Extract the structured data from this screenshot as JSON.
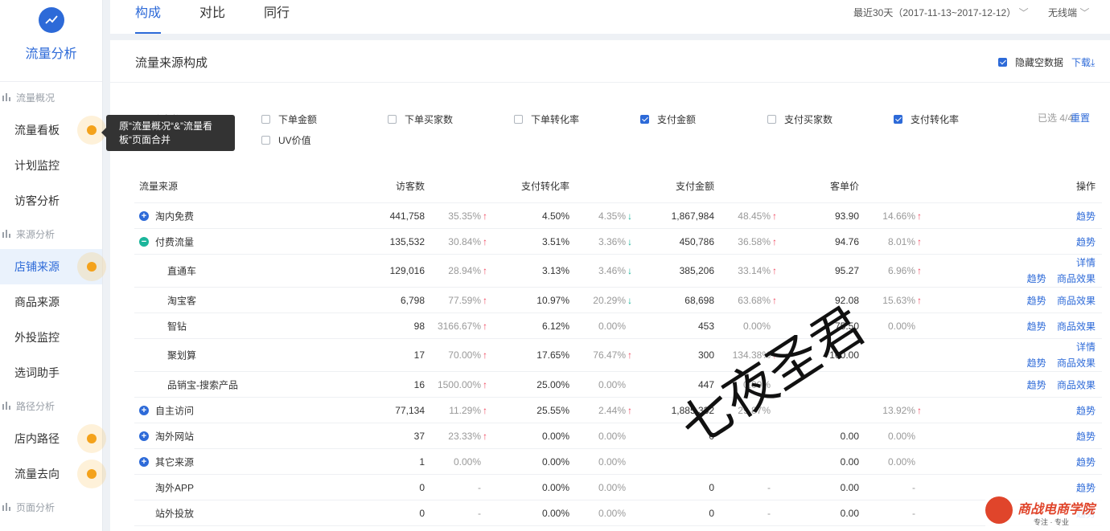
{
  "sidebar": {
    "title": "流量分析",
    "sections": [
      {
        "label": "流量概况",
        "items": [
          {
            "label": "流量看板"
          },
          {
            "label": "计划监控"
          },
          {
            "label": "访客分析"
          }
        ]
      },
      {
        "label": "来源分析",
        "items": [
          {
            "label": "店铺来源"
          },
          {
            "label": "商品来源"
          },
          {
            "label": "外投监控"
          },
          {
            "label": "选词助手"
          }
        ]
      },
      {
        "label": "路径分析",
        "items": [
          {
            "label": "店内路径"
          },
          {
            "label": "流量去向"
          }
        ]
      },
      {
        "label": "页面分析",
        "items": []
      }
    ]
  },
  "tooltip": {
    "text": "原“流量概况“&”流量看板“页面合并"
  },
  "tabs": [
    {
      "label": "构成"
    },
    {
      "label": "对比"
    },
    {
      "label": "同行"
    }
  ],
  "date_range": "最近30天（2017-11-13~2017-12-12）",
  "device": "无线端",
  "panel": {
    "title": "流量来源构成",
    "hide_empty_label": "隐藏空数据",
    "download_label": "下载",
    "metrics": [
      {
        "label": "访客数",
        "checked": true
      },
      {
        "label": "下单金额",
        "checked": false
      },
      {
        "label": "下单买家数",
        "checked": false
      },
      {
        "label": "下单转化率",
        "checked": false
      },
      {
        "label": "支付金额",
        "checked": true
      },
      {
        "label": "支付买家数",
        "checked": false
      },
      {
        "label": "支付转化率",
        "checked": true
      },
      {
        "label": "UV价值",
        "checked": false
      }
    ],
    "selected_count": "已选 4/4",
    "reset_label": "重置"
  },
  "table": {
    "headers": [
      "流量来源",
      "访客数",
      "支付转化率",
      "支付金额",
      "客单价",
      "操作"
    ],
    "trend_label": "趋势",
    "detail_label": "详情",
    "goods_effect_label": "商品效果",
    "rows": [
      {
        "name": "淘内免费",
        "expand": "plus",
        "indent": false,
        "visitors": "441,758",
        "visitors_pct": "35.35%",
        "visitors_dir": "up",
        "conv": "4.50%",
        "conv_pct": "4.35%",
        "conv_dir": "down",
        "amount": "1,867,984",
        "amount_pct": "48.45%",
        "amount_dir": "up",
        "price": "93.90",
        "price_pct": "14.66%",
        "price_dir": "up",
        "ops": "trend"
      },
      {
        "name": "付费流量",
        "expand": "minus",
        "indent": false,
        "visitors": "135,532",
        "visitors_pct": "30.84%",
        "visitors_dir": "up",
        "conv": "3.51%",
        "conv_pct": "3.36%",
        "conv_dir": "down",
        "amount": "450,786",
        "amount_pct": "36.58%",
        "amount_dir": "up",
        "price": "94.76",
        "price_pct": "8.01%",
        "price_dir": "up",
        "ops": "trend"
      },
      {
        "name": "直通车",
        "expand": "none",
        "indent": true,
        "visitors": "129,016",
        "visitors_pct": "28.94%",
        "visitors_dir": "up",
        "conv": "3.13%",
        "conv_pct": "3.46%",
        "conv_dir": "down",
        "amount": "385,206",
        "amount_pct": "33.14%",
        "amount_dir": "up",
        "price": "95.27",
        "price_pct": "6.96%",
        "price_dir": "up",
        "ops": "detail"
      },
      {
        "name": "淘宝客",
        "expand": "none",
        "indent": true,
        "visitors": "6,798",
        "visitors_pct": "77.59%",
        "visitors_dir": "up",
        "conv": "10.97%",
        "conv_pct": "20.29%",
        "conv_dir": "down",
        "amount": "68,698",
        "amount_pct": "63.68%",
        "amount_dir": "up",
        "price": "92.08",
        "price_pct": "15.63%",
        "price_dir": "up",
        "ops": "goods"
      },
      {
        "name": "智钻",
        "expand": "none",
        "indent": true,
        "visitors": "98",
        "visitors_pct": "3166.67%",
        "visitors_dir": "up",
        "conv": "6.12%",
        "conv_pct": "0.00%",
        "conv_dir": "none",
        "amount": "453",
        "amount_pct": "0.00%",
        "amount_dir": "none",
        "price": "75.50",
        "price_pct": "0.00%",
        "price_dir": "none",
        "ops": "goods"
      },
      {
        "name": "聚划算",
        "expand": "none",
        "indent": true,
        "visitors": "17",
        "visitors_pct": "70.00%",
        "visitors_dir": "up",
        "conv": "17.65%",
        "conv_pct": "76.47%",
        "conv_dir": "up",
        "amount": "300",
        "amount_pct": "134.38%",
        "amount_dir": "up",
        "price": "100.00",
        "price_pct": "",
        "price_dir": "none",
        "ops": "detail"
      },
      {
        "name": "品销宝-搜索产品",
        "expand": "none",
        "indent": true,
        "visitors": "16",
        "visitors_pct": "1500.00%",
        "visitors_dir": "up",
        "conv": "25.00%",
        "conv_pct": "0.00%",
        "conv_dir": "none",
        "amount": "447",
        "amount_pct": "0.00%",
        "amount_dir": "none",
        "price": "",
        "price_pct": "",
        "price_dir": "none",
        "ops": "goods"
      },
      {
        "name": "自主访问",
        "expand": "plus",
        "indent": false,
        "visitors": "77,134",
        "visitors_pct": "11.29%",
        "visitors_dir": "up",
        "conv": "25.55%",
        "conv_pct": "2.44%",
        "conv_dir": "up",
        "amount": "1,885,332",
        "amount_pct": "29.87%",
        "amount_dir": "none",
        "price": "",
        "price_pct": "13.92%",
        "price_dir": "up",
        "ops": "trend"
      },
      {
        "name": "淘外网站",
        "expand": "plus",
        "indent": false,
        "visitors": "37",
        "visitors_pct": "23.33%",
        "visitors_dir": "up",
        "conv": "0.00%",
        "conv_pct": "0.00%",
        "conv_dir": "none",
        "amount": "0",
        "amount_pct": "",
        "amount_dir": "none",
        "price": "0.00",
        "price_pct": "0.00%",
        "price_dir": "none",
        "ops": "trend"
      },
      {
        "name": "其它来源",
        "expand": "plus",
        "indent": false,
        "visitors": "1",
        "visitors_pct": "0.00%",
        "visitors_dir": "none",
        "conv": "0.00%",
        "conv_pct": "0.00%",
        "conv_dir": "none",
        "amount": "",
        "amount_pct": "",
        "amount_dir": "none",
        "price": "0.00",
        "price_pct": "0.00%",
        "price_dir": "none",
        "ops": "trend"
      },
      {
        "name": "淘外APP",
        "expand": "none",
        "indent": false,
        "visitors": "0",
        "visitors_pct": "-",
        "visitors_dir": "none",
        "conv": "0.00%",
        "conv_pct": "0.00%",
        "conv_dir": "none",
        "amount": "0",
        "amount_pct": "-",
        "amount_dir": "none",
        "price": "0.00",
        "price_pct": "-",
        "price_dir": "none",
        "ops": "trend"
      },
      {
        "name": "站外投放",
        "expand": "none",
        "indent": false,
        "visitors": "0",
        "visitors_pct": "-",
        "visitors_dir": "none",
        "conv": "0.00%",
        "conv_pct": "0.00%",
        "conv_dir": "none",
        "amount": "0",
        "amount_pct": "-",
        "amount_dir": "none",
        "price": "0.00",
        "price_pct": "-",
        "price_dir": "none",
        "ops": "trend"
      }
    ]
  },
  "watermark": {
    "text": "七夜圣君"
  },
  "corner_logo": {
    "title": "商战电商学院",
    "subtitle": "专注 · 专业"
  }
}
